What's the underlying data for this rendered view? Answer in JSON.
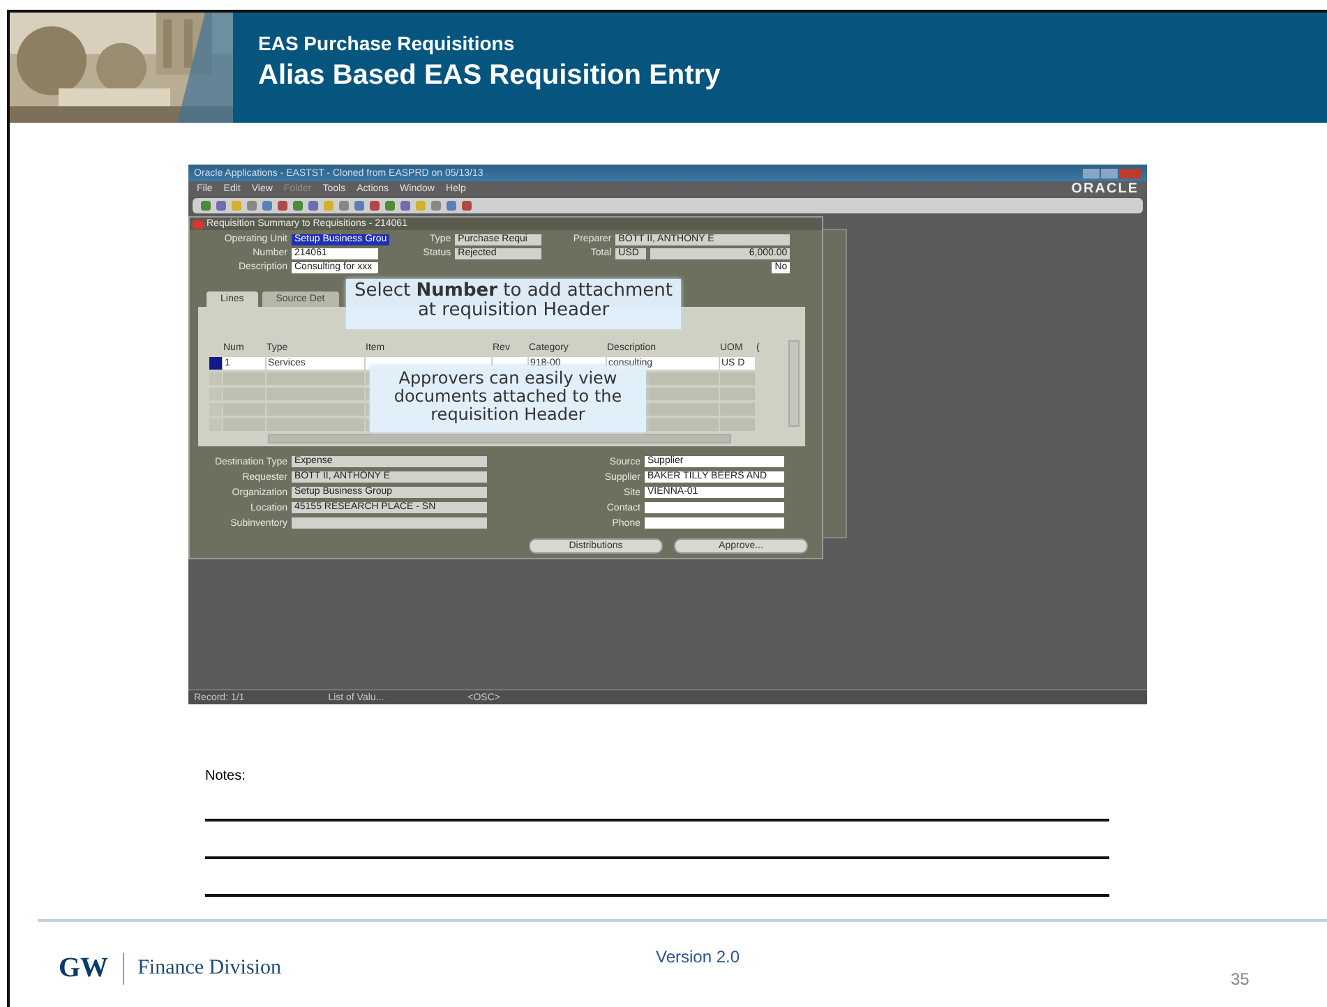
{
  "header": {
    "subtitle": "EAS Purchase Requisitions",
    "title": "Alias Based EAS Requisition Entry"
  },
  "app": {
    "title": "Oracle Applications - EASTST - Cloned from EASPRD on 05/13/13",
    "brand": "ORACLE",
    "menu": [
      {
        "label": "File",
        "disabled": false
      },
      {
        "label": "Edit",
        "disabled": false
      },
      {
        "label": "View",
        "disabled": false
      },
      {
        "label": "Folder",
        "disabled": true
      },
      {
        "label": "Tools",
        "disabled": false
      },
      {
        "label": "Actions",
        "disabled": false
      },
      {
        "label": "Window",
        "disabled": false
      },
      {
        "label": "Help",
        "disabled": false
      }
    ],
    "form": {
      "title": "Requisition Summary to Requisitions - 214061",
      "left_fields": [
        {
          "label": "Operating Unit",
          "value": "Setup Business Grou",
          "focused": true
        },
        {
          "label": "Number",
          "value": "214061",
          "focused": false
        },
        {
          "label": "Description",
          "value": "Consulting for xxx",
          "focused": false
        }
      ],
      "mid_fields": [
        {
          "label": "Type",
          "value": "Purchase Requi"
        },
        {
          "label": "Status",
          "value": "Rejected"
        }
      ],
      "right_fields": [
        {
          "label": "Preparer",
          "value": "BOTT II, ANTHONY E"
        },
        {
          "label": "Total",
          "currency": "USD",
          "value": "6,000.00"
        }
      ],
      "flag": "No",
      "tabs": [
        {
          "label": "Lines",
          "selected": true
        },
        {
          "label": "Source Det",
          "selected": false
        }
      ],
      "columns": [
        "Num",
        "Type",
        "Item",
        "Rev",
        "Category",
        "Description",
        "UOM",
        "("
      ],
      "rows": [
        {
          "selected": true,
          "cells": [
            "1",
            "Services",
            "",
            "",
            "918-00",
            "consulting",
            "US D"
          ]
        }
      ],
      "bottom_left": [
        {
          "label": "Destination Type",
          "value": "Expense"
        },
        {
          "label": "Requester",
          "value": "BOTT II, ANTHONY E"
        },
        {
          "label": "Organization",
          "value": "Setup Business Group"
        },
        {
          "label": "Location",
          "value": "45155 RESEARCH PLACE - SN"
        },
        {
          "label": "Subinventory"
        }
      ],
      "bottom_right": [
        {
          "label": "Source",
          "value": "Supplier"
        },
        {
          "label": "Supplier",
          "value": "BAKER TILLY BEERS AND"
        },
        {
          "label": "Site",
          "value": "VIENNA-01"
        },
        {
          "label": "Contact"
        },
        {
          "label": "Phone"
        }
      ],
      "buttons": [
        "Distributions",
        "Approve..."
      ]
    },
    "status_bar": [
      "Record: 1/1",
      "List of Valu...",
      "<OSC>"
    ],
    "callouts": [
      "Select **Number** to add attachment at requisition Header",
      "Approvers can easily view documents attached to the requisition Header"
    ]
  },
  "notes": {
    "label": "Notes:"
  },
  "footer": {
    "logo": "GW",
    "division": "Finance Division",
    "version": "Version 2.0",
    "page": "35"
  }
}
